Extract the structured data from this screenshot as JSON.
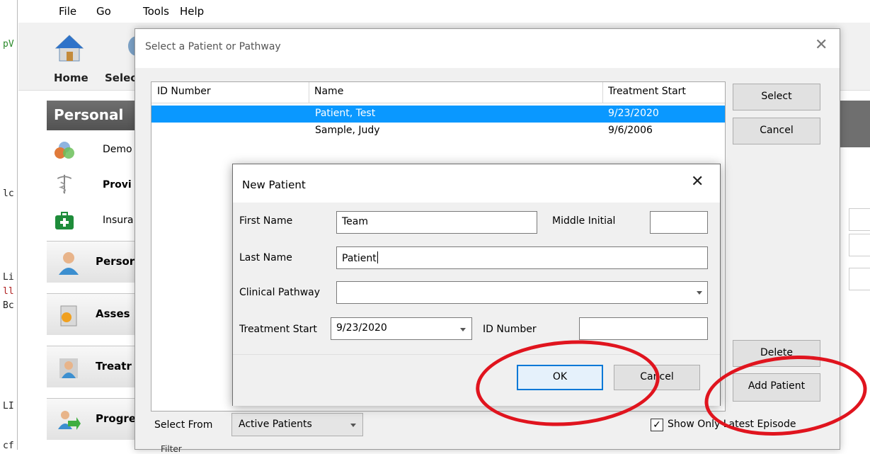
{
  "code_strip": {
    "lines": [
      "pV",
      "lc",
      "Li",
      "ll",
      "Bc",
      "LI",
      "cf"
    ]
  },
  "menu": [
    "File",
    "Go",
    "Tools",
    "Help"
  ],
  "toolbar": {
    "home_label": "Home",
    "select_label": "Selec"
  },
  "sidebar": {
    "header": "Personal",
    "sub_items": [
      {
        "label": "Demo",
        "icon": "demographics-icon"
      },
      {
        "label": "Provi",
        "icon": "caduceus-icon"
      },
      {
        "label": "Insura",
        "icon": "first-aid-kit-icon"
      }
    ],
    "big_items": [
      {
        "label": "Persor",
        "icon": "person-icon"
      },
      {
        "label": "Asses",
        "icon": "assessment-icon"
      },
      {
        "label": "Treatr",
        "icon": "treatment-icon"
      },
      {
        "label": "Progre",
        "icon": "progress-icon"
      }
    ]
  },
  "select_dialog": {
    "title": "Select a Patient or Pathway",
    "columns": [
      "ID Number",
      "Name",
      "Treatment Start"
    ],
    "rows": [
      {
        "id": "",
        "name": "Patient, Test",
        "start": "9/23/2020",
        "selected": true
      },
      {
        "id": "",
        "name": "Sample, Judy",
        "start": "9/6/2006",
        "selected": false
      }
    ],
    "buttons": {
      "select": "Select",
      "cancel": "Cancel",
      "delete": "Delete",
      "add_patient": "Add Patient"
    },
    "select_from_label": "Select From",
    "select_from_value": "Active Patients",
    "show_latest_label": "Show Only Latest Episode",
    "show_latest_checked": true,
    "filter_label": "Filter"
  },
  "new_patient_dialog": {
    "title": "New Patient",
    "first_name_label": "First Name",
    "first_name_value": "Team",
    "middle_initial_label": "Middle Initial",
    "middle_initial_value": "",
    "last_name_label": "Last Name",
    "last_name_value": "Patient",
    "clinical_pathway_label": "Clinical Pathway",
    "clinical_pathway_value": "",
    "treatment_start_label": "Treatment Start",
    "treatment_start_value": "9/23/2020",
    "id_number_label": "ID Number",
    "id_number_value": "",
    "ok_label": "OK",
    "cancel_label": "Cancel"
  },
  "colors": {
    "selection": "#0a98ff",
    "annotation": "#e0141e",
    "focus_border": "#0078d7"
  }
}
